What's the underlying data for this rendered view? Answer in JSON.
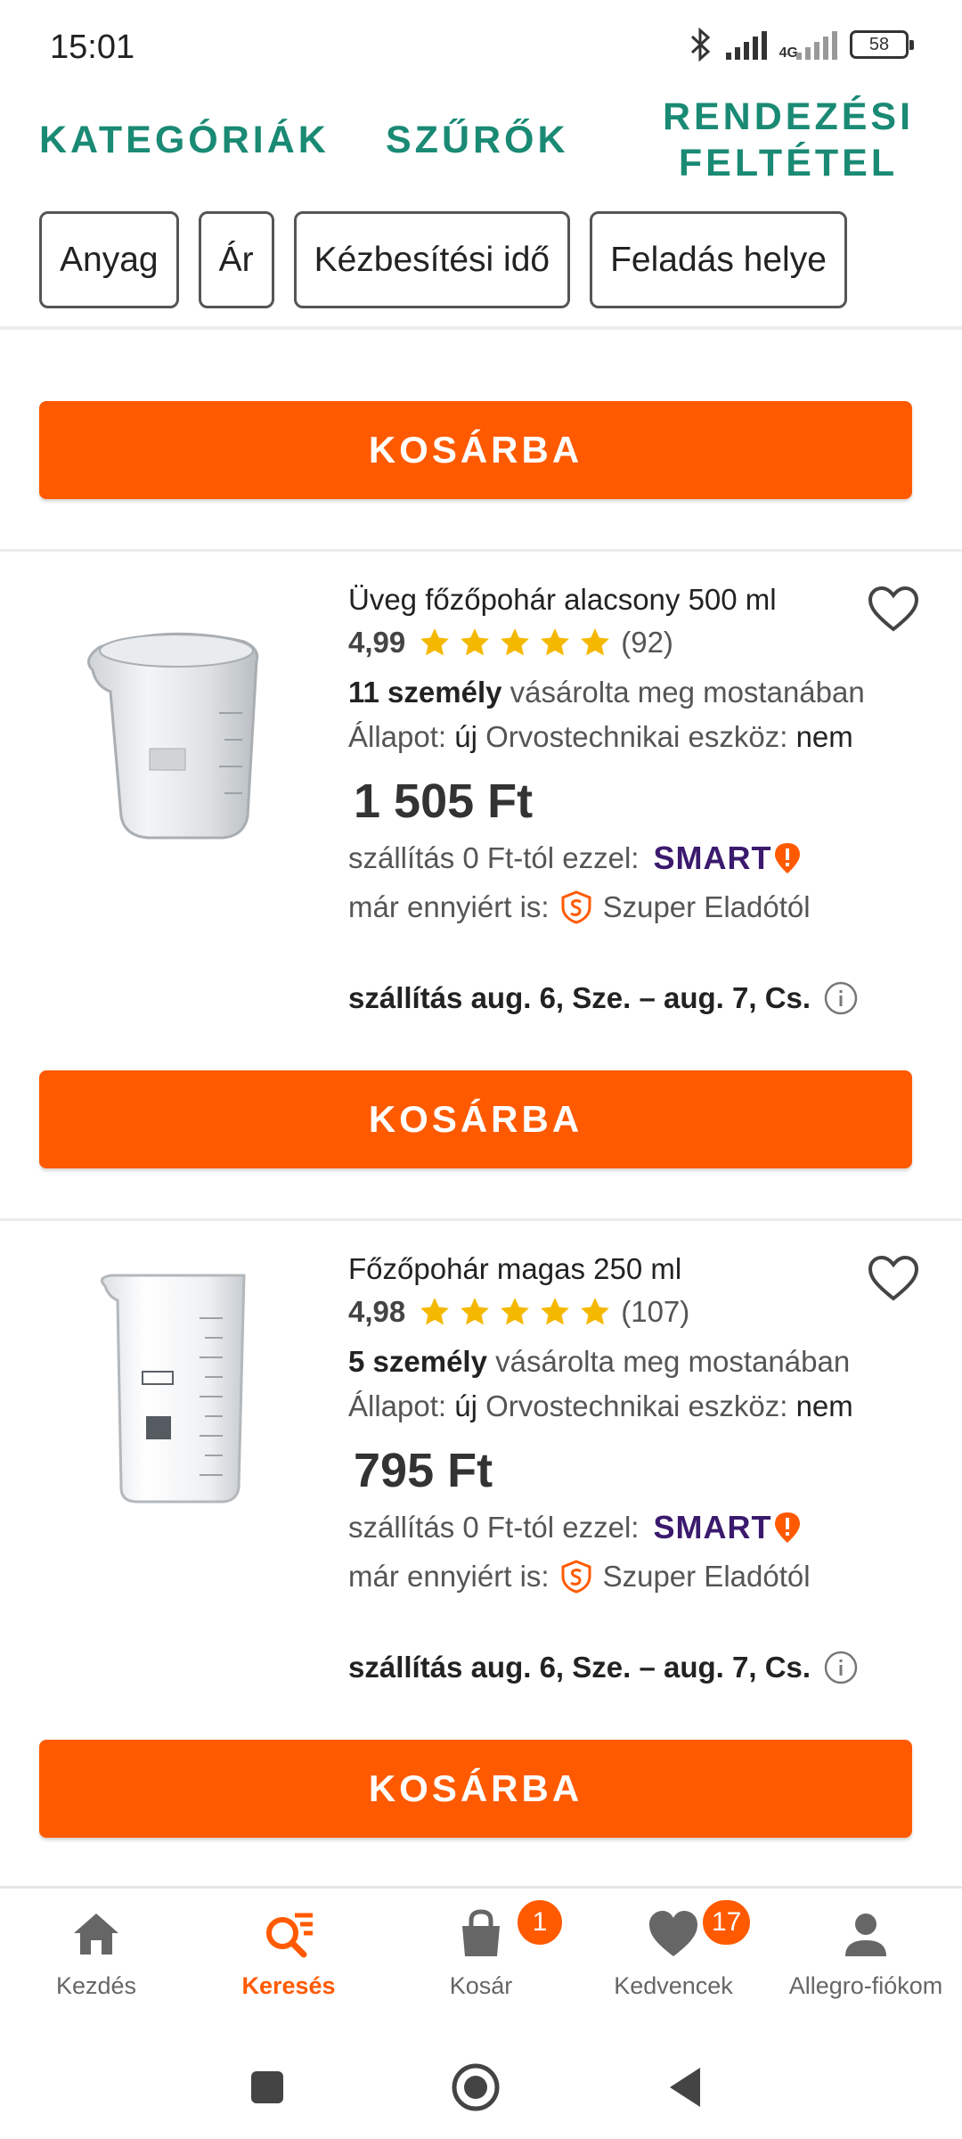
{
  "status_bar": {
    "time": "15:01",
    "network": "4G",
    "battery": "58"
  },
  "top_nav": {
    "categories": "KATEGÓRIÁK",
    "filters": "SZŰRŐK",
    "sort_line1": "RENDEZÉSI",
    "sort_line2": "FELTÉTEL"
  },
  "filter_chips": [
    "Anyag",
    "Ár",
    "Kézbesítési idő",
    "Feladás helye"
  ],
  "cart_button_label": "KOSÁRBA",
  "products": [
    {
      "title": "Üveg főzőpohár alacsony 500 ml",
      "rating": "4,99",
      "stars": 5,
      "rating_count": "(92)",
      "buyers_bold": "11 személy",
      "buyers_rest": " vásárolta meg mostanában",
      "condition_label": "Állapot: ",
      "condition_value": "új",
      "medical_label": " Orvostechnikai eszköz: ",
      "medical_value": "nem",
      "price": "1 505 Ft",
      "shipping_from": "szállítás 0 Ft-tól ezzel:",
      "smart": "SMART",
      "seller_prefix": "már ennyiért is:",
      "seller": "Szuper Eladótól",
      "delivery": "szállítás aug. 6, Sze. – aug. 7, Cs."
    },
    {
      "title": "Főzőpohár magas 250 ml",
      "rating": "4,98",
      "stars": 5,
      "rating_count": "(107)",
      "buyers_bold": "5 személy",
      "buyers_rest": " vásárolta meg mostanában",
      "condition_label": "Állapot: ",
      "condition_value": "új",
      "medical_label": " Orvostechnikai eszköz: ",
      "medical_value": "nem",
      "price": "795 Ft",
      "shipping_from": "szállítás 0 Ft-tól ezzel:",
      "smart": "SMART",
      "seller_prefix": "már ennyiért is:",
      "seller": "Szuper Eladótól",
      "delivery": "szállítás aug. 6, Sze. – aug. 7, Cs."
    }
  ],
  "bottom_nav": [
    {
      "label": "Kezdés",
      "icon": "home-icon"
    },
    {
      "label": "Keresés",
      "icon": "search-icon",
      "active": true
    },
    {
      "label": "Kosár",
      "icon": "cart-icon",
      "badge": "1"
    },
    {
      "label": "Kedvencek",
      "icon": "heart-icon",
      "badge": "17"
    },
    {
      "label": "Allegro-fiókom",
      "icon": "account-icon"
    }
  ],
  "colors": {
    "accent": "#ff5a00",
    "nav_green": "#1a8a74",
    "star": "#f5b800",
    "smart_purple": "#3b1a6e"
  }
}
